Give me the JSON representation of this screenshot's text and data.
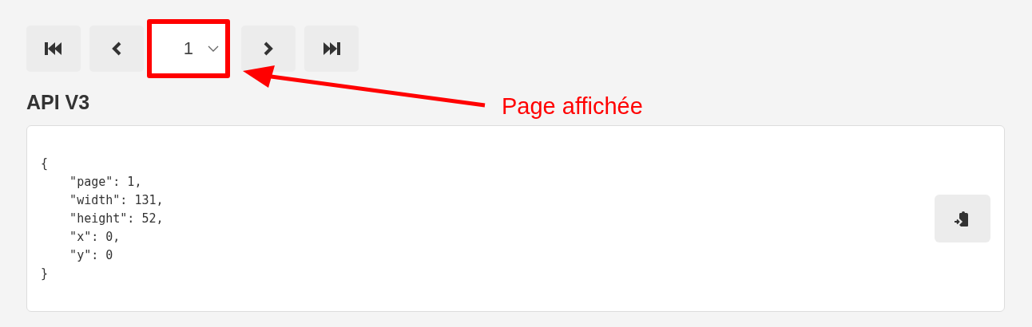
{
  "pager": {
    "buttons": [
      {
        "kind": "first"
      },
      {
        "kind": "prev"
      },
      {
        "kind": "select",
        "value": "1"
      },
      {
        "kind": "next"
      },
      {
        "kind": "last"
      }
    ]
  },
  "section": {
    "title": "API V3"
  },
  "code": {
    "lines": [
      "{",
      "    \"page\": 1,",
      "    \"width\": 131,",
      "    \"height\": 52,",
      "    \"x\": 0,",
      "    \"y\": 0",
      "}"
    ]
  },
  "annotation": {
    "label": "Page affichée"
  }
}
